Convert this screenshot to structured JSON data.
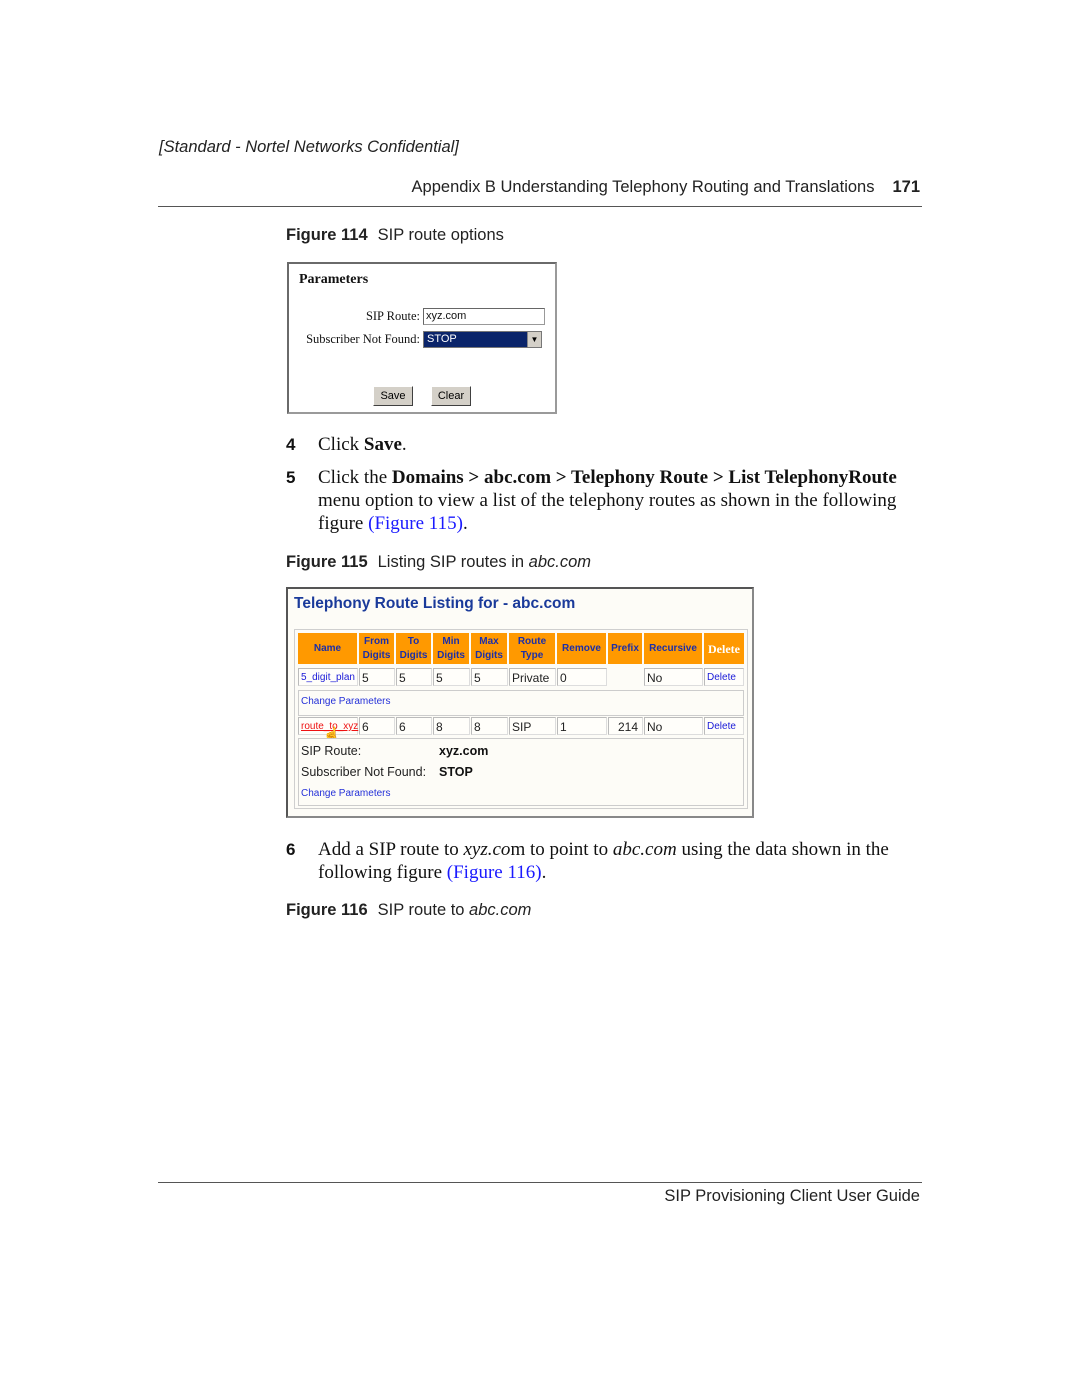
{
  "header": {
    "confidential": "[Standard - Nortel Networks Confidential]",
    "running_head": "Appendix B  Understanding Telephony Routing and Translations",
    "page_number": "171"
  },
  "figure114": {
    "label": "Figure 114",
    "caption": "SIP route options",
    "ui": {
      "title": "Parameters",
      "sip_route_label": "SIP Route:",
      "sip_route_value": "xyz.com",
      "subscriber_not_found_label": "Subscriber Not Found:",
      "subscriber_not_found_value": "STOP",
      "save_label": "Save",
      "clear_label": "Clear"
    }
  },
  "steps": {
    "s4": {
      "num": "4",
      "pre": "Click ",
      "bold": "Save",
      "post": "."
    },
    "s5": {
      "num": "5",
      "pre": "Click the ",
      "bold": "Domains > abc.com > Telephony Route > List TelephonyRoute",
      "post": " menu option to view a list of the telephony routes as shown in the following figure ",
      "link": "(Figure 115)",
      "end": "."
    },
    "s6": {
      "num": "6",
      "pre": "Add a SIP route to ",
      "it1": "xyz.co",
      "mid1": "m to point to ",
      "it2": "abc.com",
      "mid2": " using the data shown in the following figure ",
      "link": "(Figure 116)",
      "end": "."
    }
  },
  "figure115": {
    "label": "Figure 115",
    "caption_pre": "Listing SIP routes in ",
    "caption_it": "abc.com",
    "ui": {
      "title": "Telephony Route Listing for - abc.com",
      "headers": [
        "Name",
        "From Digits",
        "To Digits",
        "Min Digits",
        "Max Digits",
        "Route Type",
        "Remove",
        "Prefix",
        "Recursive",
        "Delete"
      ],
      "rows": [
        {
          "name": "5_digit_plan",
          "from": "5",
          "to": "5",
          "min": "5",
          "max": "5",
          "type": "Private",
          "remove": "0",
          "prefix": "",
          "recursive": "No",
          "delete": "Delete"
        },
        {
          "name": "route_to_xyz",
          "from": "6",
          "to": "6",
          "min": "8",
          "max": "8",
          "type": "SIP",
          "remove": "1",
          "prefix": "214",
          "recursive": "No",
          "delete": "Delete"
        }
      ],
      "change_parameters": "Change Parameters",
      "detail": {
        "sip_route_label": "SIP Route:",
        "sip_route_value": "xyz.com",
        "snf_label": "Subscriber Not Found:",
        "snf_value": "STOP"
      }
    }
  },
  "figure116": {
    "label": "Figure 116",
    "caption_pre": "SIP route to ",
    "caption_it": "abc.com"
  },
  "footer": {
    "title": "SIP Provisioning Client User Guide"
  }
}
